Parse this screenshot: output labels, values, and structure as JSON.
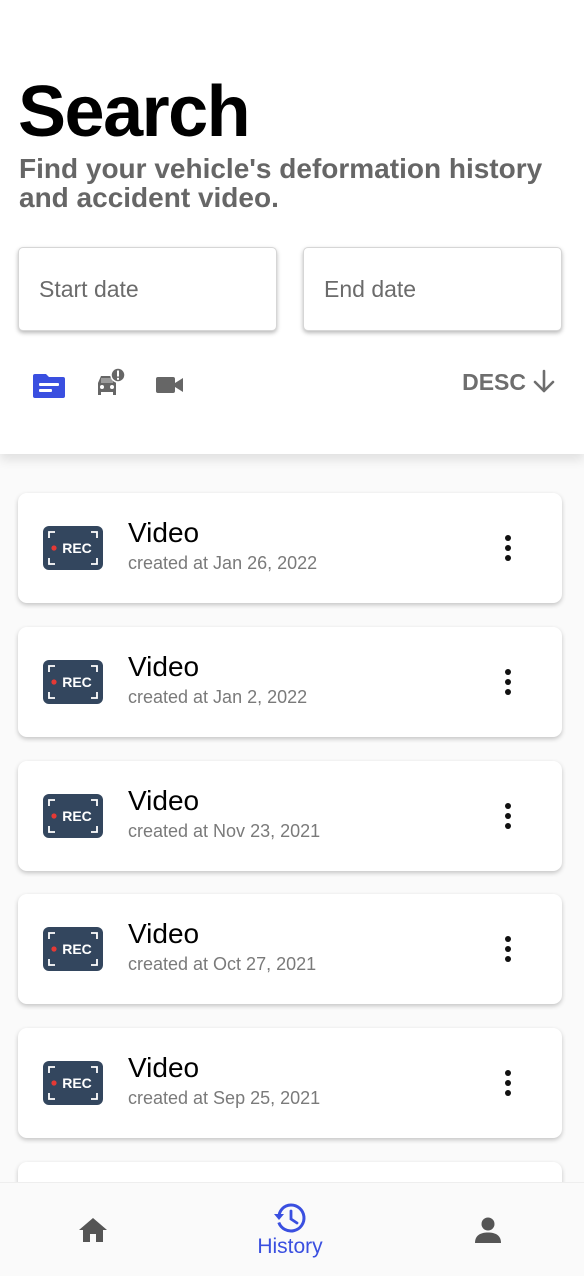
{
  "header": {
    "title": "Search",
    "subtitle": "Find your vehicle's deformation history and accident video."
  },
  "date_filter": {
    "start_placeholder": "Start date",
    "end_placeholder": "End date"
  },
  "filters": [
    {
      "icon": "document-icon",
      "active": true
    },
    {
      "icon": "car-alert-icon",
      "active": false
    },
    {
      "icon": "video-camera-icon",
      "active": false
    }
  ],
  "sort": {
    "label": "DESC",
    "icon": "arrow-down-icon"
  },
  "items": [
    {
      "title": "Video",
      "subtitle": "created at Jan 26, 2022",
      "badge": "REC"
    },
    {
      "title": "Video",
      "subtitle": "created at Jan 2, 2022",
      "badge": "REC"
    },
    {
      "title": "Video",
      "subtitle": "created at Nov 23, 2021",
      "badge": "REC"
    },
    {
      "title": "Video",
      "subtitle": "created at Oct 27, 2021",
      "badge": "REC"
    },
    {
      "title": "Video",
      "subtitle": "created at Sep 25, 2021",
      "badge": "REC"
    }
  ],
  "bottom_nav": {
    "home_icon": "home-icon",
    "history_label": "History",
    "history_icon": "history-icon",
    "profile_icon": "person-icon"
  },
  "colors": {
    "accent": "#3a4fe0",
    "rec_badge_bg": "#33465e",
    "rec_dot": "#e53935",
    "icon_gray": "#666666"
  }
}
